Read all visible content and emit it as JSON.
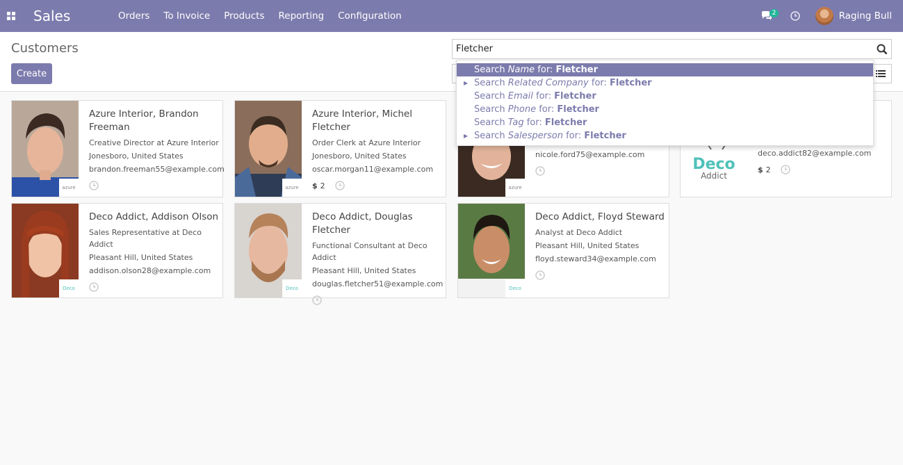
{
  "nav": {
    "app_name": "Sales",
    "menu": [
      "Orders",
      "To Invoice",
      "Products",
      "Reporting",
      "Configuration"
    ],
    "chat_badge": "2",
    "user": "Raging Bull"
  },
  "control": {
    "title": "Customers",
    "create_label": "Create",
    "search_value": "Fletcher"
  },
  "autocomplete": [
    {
      "prefix": "Search ",
      "field": "Name",
      "mid": " for: ",
      "term": "Fletcher",
      "expandable": false,
      "active": true
    },
    {
      "prefix": "Search ",
      "field": "Related Company",
      "mid": " for: ",
      "term": "Fletcher",
      "expandable": true,
      "active": false
    },
    {
      "prefix": "Search ",
      "field": "Email",
      "mid": " for: ",
      "term": "Fletcher",
      "expandable": false,
      "active": false
    },
    {
      "prefix": "Search ",
      "field": "Phone",
      "mid": " for: ",
      "term": "Fletcher",
      "expandable": false,
      "active": false
    },
    {
      "prefix": "Search ",
      "field": "Tag",
      "mid": " for: ",
      "term": "Fletcher",
      "expandable": false,
      "active": false
    },
    {
      "prefix": "Search ",
      "field": "Salesperson",
      "mid": " for: ",
      "term": "Fletcher",
      "expandable": true,
      "active": false
    }
  ],
  "cards": [
    {
      "name": "Azure Interior, Brandon Freeman",
      "job": "Creative Director at Azure Interior",
      "location": "Jonesboro, United States",
      "email": "brandon.freeman55@example.com",
      "sales": "",
      "company_logo": "azure"
    },
    {
      "name": "Azure Interior, Michel Fletcher",
      "job": "Order Clerk at Azure Interior",
      "location": "Jonesboro, United States",
      "email": "oscar.morgan11@example.com",
      "sales": "2",
      "company_logo": "azure"
    },
    {
      "name": "",
      "job": "",
      "location": "",
      "email": "nicole.ford75@example.com",
      "sales": "",
      "company_logo": "azure"
    },
    {
      "name": "",
      "job": "",
      "location": "",
      "email": "deco.addict82@example.com",
      "sales": "2",
      "company_logo": "deco",
      "logo_text_1": "Deco",
      "logo_text_2": "Addict"
    },
    {
      "name": "Deco Addict, Addison Olson",
      "job": "Sales Representative at Deco Addict",
      "location": "Pleasant Hill, United States",
      "email": "addison.olson28@example.com",
      "sales": "",
      "company_logo": "deco"
    },
    {
      "name": "Deco Addict, Douglas Fletcher",
      "job": "Functional Consultant at Deco Addict",
      "location": "Pleasant Hill, United States",
      "email": "douglas.fletcher51@example.com",
      "sales": "",
      "company_logo": "deco"
    },
    {
      "name": "Deco Addict, Floyd Steward",
      "job": "Analyst at Deco Addict",
      "location": "Pleasant Hill, United States",
      "email": "floyd.steward34@example.com",
      "sales": "",
      "company_logo": "deco"
    }
  ],
  "colors": {
    "brand": "#7c7bad",
    "badge": "#21b799",
    "deco": "#4fc1b9"
  }
}
